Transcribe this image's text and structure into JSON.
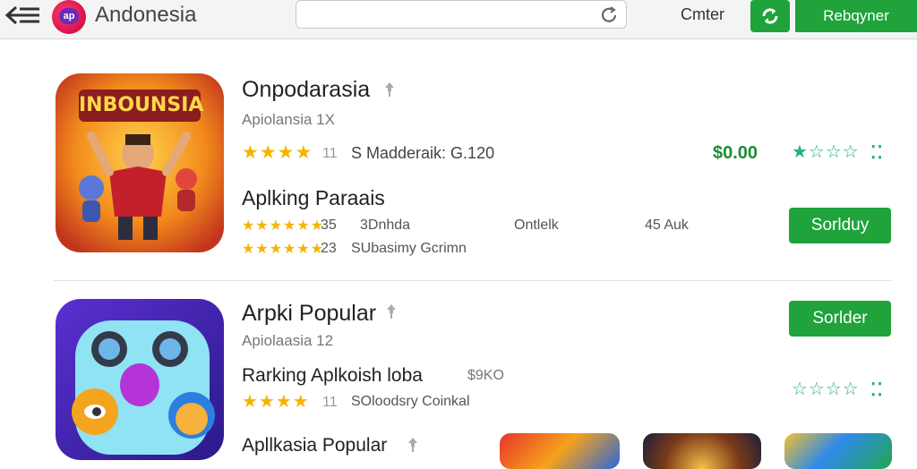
{
  "header": {
    "app_title": "Andonesia",
    "logo_text": "ap",
    "search_placeholder": "",
    "center_link": "Cmter",
    "primary_button": "Rebqyner",
    "icons": [
      "back-arrow-icon",
      "logo-icon",
      "refresh-icon",
      "sync-icon"
    ]
  },
  "apps": [
    {
      "title": "Onpodarasia",
      "category": "Apiolansia 1X",
      "rating_line": "S Madderaik: G.120",
      "rating_count": "11",
      "price": "$0.00",
      "icon_text": "INBOUNSIA"
    },
    {
      "title": "Aplking Paraais",
      "stats_row1": [
        "35",
        "3Dnhda",
        "Ontlelk",
        "45 Auk"
      ],
      "stats_row2": [
        "23",
        "SUbasimy Gcrimn"
      ],
      "button_label": "Sorlduy"
    },
    {
      "title": "Arpki Popular",
      "category": "Apiolaasia 12",
      "button_label": "Sorlder"
    },
    {
      "title": "Rarking Aplkoish loba",
      "price": "$9KO",
      "rating_count": "11",
      "rating_line": "SOloodsry Coinkal"
    },
    {
      "title": "Apllkasia Popular"
    }
  ],
  "colors": {
    "accent_green": "#1fa33a",
    "star_yellow": "#f5b400",
    "star_outline_green": "#1fb27a"
  }
}
